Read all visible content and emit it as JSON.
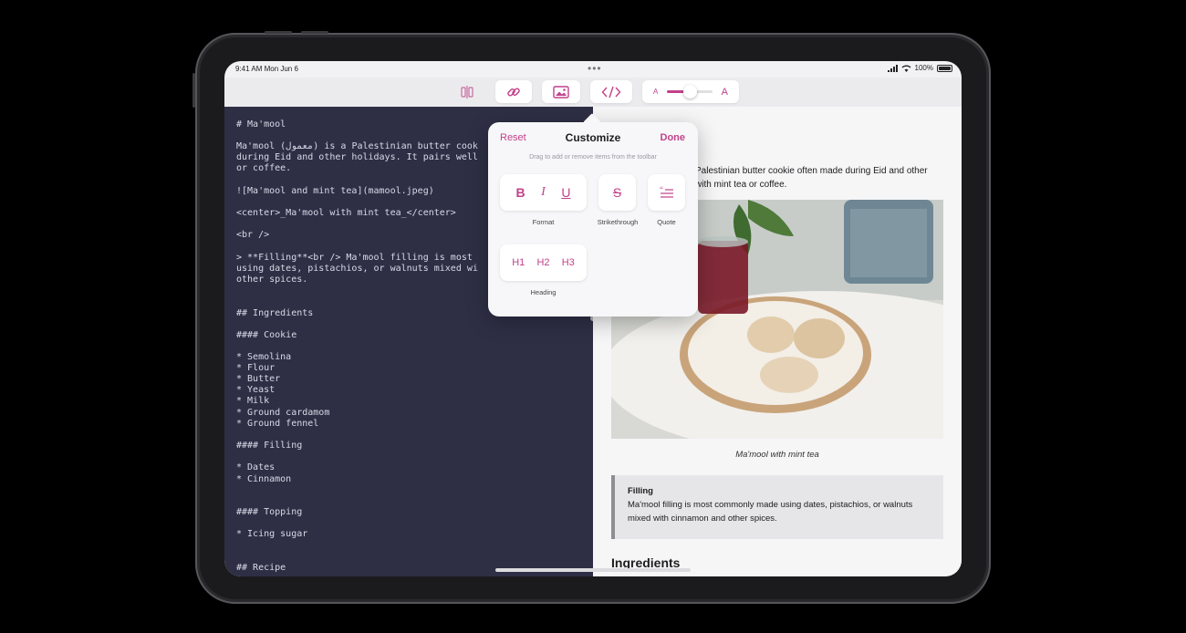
{
  "status_bar": {
    "time": "9:41 AM  Mon Jun 6",
    "battery": "100%"
  },
  "toolbar": {
    "split_icon": "split-view-icon",
    "link_icon": "link-icon",
    "image_icon": "image-icon",
    "code_icon": "code-icon",
    "font_small": "A",
    "font_large": "A",
    "font_slider_value": 0.5
  },
  "popover": {
    "reset": "Reset",
    "title": "Customize",
    "done": "Done",
    "hint": "Drag to add or remove items from the toolbar",
    "format": {
      "bold": "B",
      "italic": "I",
      "underline": "U",
      "label": "Format"
    },
    "strikethrough": {
      "glyph": "S",
      "label": "Strikethrough"
    },
    "quote": {
      "label": "Quote"
    },
    "heading": {
      "h1": "H1",
      "h2": "H2",
      "h3": "H3",
      "label": "Heading"
    }
  },
  "editor": {
    "lines": [
      "# Ma'mool",
      "Ma'mool (معمول) is a Palestinian butter cook",
      "during Eid and other holidays. It pairs well",
      "or coffee.",
      "![Ma'mool and mint tea](mamool.jpeg)",
      "<center>_Ma'mool with mint tea_</center>",
      "<br />",
      "> **Filling**<br /> Ma'mool filling is most",
      "using dates, pistachios, or walnuts mixed wi",
      "other spices.",
      "## Ingredients",
      "#### Cookie",
      "* Semolina",
      "* Flour",
      "* Butter",
      "* Yeast",
      "* Milk",
      "* Ground cardamom",
      "* Ground fennel",
      "#### Filling",
      "* Dates",
      "* Cinnamon",
      "#### Topping",
      "* Icing sugar",
      "## Recipe"
    ]
  },
  "preview": {
    "para_line1": "Palestinian butter cookie often made during Eid and other",
    "para_line2": "with mint tea or coffee.",
    "caption": "Ma'mool with mint tea",
    "quote_title": "Filling",
    "quote_line1": "Ma'mool filling is most commonly made using dates, pistachios, or walnuts",
    "quote_line2": "mixed with cinnamon and other spices.",
    "heading": "Ingredients"
  },
  "colors": {
    "accent": "#c2418a",
    "editor_bg": "#2e2f45"
  }
}
